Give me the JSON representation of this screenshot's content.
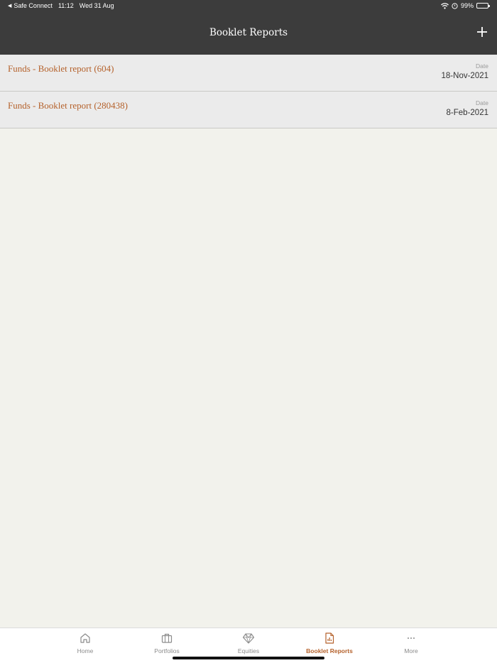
{
  "status_bar": {
    "back_app": "Safe Connect",
    "time": "11:12",
    "date": "Wed 31 Aug",
    "battery": "99%"
  },
  "nav": {
    "title": "Booklet Reports"
  },
  "reports": [
    {
      "name": "Funds - Booklet report (604)",
      "date_label": "Date",
      "date": "18-Nov-2021"
    },
    {
      "name": "Funds - Booklet report (280438)",
      "date_label": "Date",
      "date": "8-Feb-2021"
    }
  ],
  "tabs": [
    {
      "label": "Home",
      "icon": "home-icon"
    },
    {
      "label": "Portfolios",
      "icon": "briefcase-icon"
    },
    {
      "label": "Equities",
      "icon": "diamond-icon"
    },
    {
      "label": "Booklet Reports",
      "icon": "report-icon",
      "active": true
    },
    {
      "label": "More",
      "icon": "more-icon"
    }
  ],
  "colors": {
    "header_bg": "#3c3c3c",
    "accent": "#b5622c",
    "page_bg": "#f2f2ec",
    "row_bg": "#ebebeb"
  }
}
